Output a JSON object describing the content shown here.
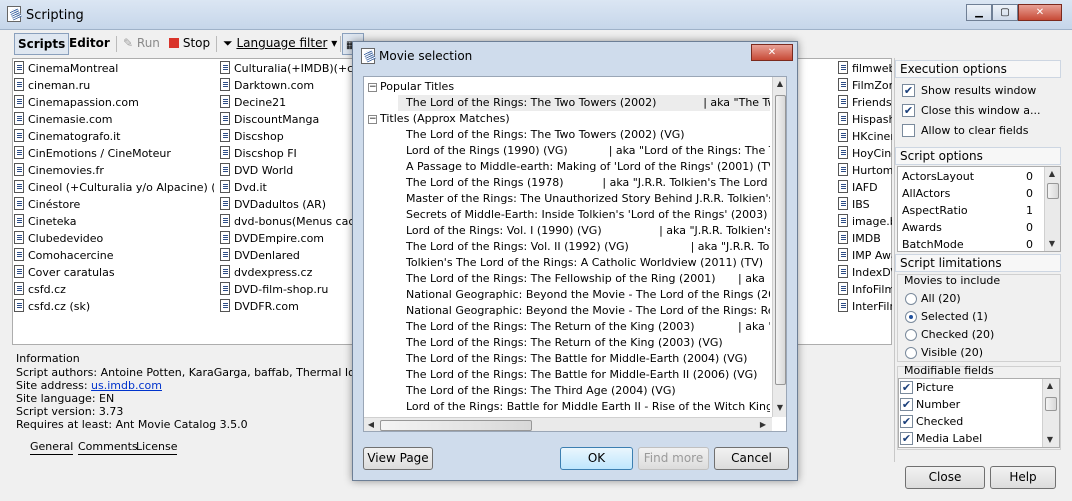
{
  "window": {
    "title": "Scripting"
  },
  "toolbar": {
    "scripts": "Scripts",
    "editor": "Editor",
    "run": "Run",
    "stop": "Stop",
    "language_filter": "Language filter"
  },
  "scripts_col1": [
    "CinemaMontreal",
    "cineman.ru",
    "Cinemapassion.com",
    "Cinemasie.com",
    "Cinematografo.it",
    "CinEmotions / CineMoteur",
    "Cinemovies.fr",
    "Cineol (+Culturalia y/o Alpacine) (ES)",
    "Cinéstore",
    "Cineteka",
    "Clubedevideo",
    "Comohacercine",
    "Cover caratulas",
    "csfd.cz",
    "csfd.cz (sk)"
  ],
  "scripts_col2": [
    "Culturalia(+IMDB)(+cara",
    "Darktown.com",
    "Decine21",
    "DiscountManga",
    "Discshop",
    "Discshop FI",
    "DVD World",
    "Dvd.it",
    "DVDadultos (AR)",
    "dvd-bonus(Menus cache",
    "DVDEmpire.com",
    "DVDenlared",
    "dvdexpress.cz",
    "DVD-film-shop.ru",
    "DVDFR.com"
  ],
  "scripts_col3": [
    "filmweb.",
    "FilmZona",
    "Friends-",
    "Hispasha",
    "HKcinem",
    "HoyCine",
    "HurtomC",
    "IAFD",
    "IBS",
    "image.b",
    "IMDB",
    "IMP Awa",
    "IndexDV",
    "InfoFilm",
    "InterFilm"
  ],
  "info": {
    "heading": "Information",
    "authors": "Script authors: Antoine Potten, KaraGarga, baffab, Thermal Ions, bad",
    "site_label": "Site address: ",
    "site_link": "us.imdb.com",
    "language": "Site language: EN",
    "version": "Script version: 3.73",
    "requires": "Requires at least: Ant Movie Catalog 3.5.0"
  },
  "tabs": [
    "General",
    "Comments",
    "License"
  ],
  "execution_options": {
    "heading": "Execution options",
    "items": [
      {
        "label": "Show results window",
        "checked": true
      },
      {
        "label": "Close this window a...",
        "checked": true
      },
      {
        "label": "Allow to clear fields",
        "checked": false
      }
    ]
  },
  "script_options": {
    "heading": "Script options",
    "items": [
      {
        "name": "ActorsLayout",
        "value": "0"
      },
      {
        "name": "AllActors",
        "value": "0"
      },
      {
        "name": "AspectRatio",
        "value": "1"
      },
      {
        "name": "Awards",
        "value": "0"
      },
      {
        "name": "BatchMode",
        "value": "0"
      }
    ]
  },
  "script_limitations": {
    "heading": "Script limitations",
    "movies_label": "Movies to include",
    "radios": [
      {
        "label": "All (20)",
        "selected": false
      },
      {
        "label": "Selected (1)",
        "selected": true
      },
      {
        "label": "Checked (20)",
        "selected": false
      },
      {
        "label": "Visible (20)",
        "selected": false
      }
    ],
    "fields_label": "Modifiable fields",
    "fields": [
      {
        "label": "Picture",
        "checked": true
      },
      {
        "label": "Number",
        "checked": true
      },
      {
        "label": "Checked",
        "checked": true
      },
      {
        "label": "Media Label",
        "checked": true
      }
    ]
  },
  "main_buttons": {
    "close": "Close",
    "help": "Help"
  },
  "dialog": {
    "title": "Movie selection",
    "popular_heading": "Popular Titles",
    "popular": [
      {
        "title": "The Lord of the Rings: The Two Towers (2002)",
        "aka": "| aka \"The Two"
      }
    ],
    "approx_heading": "Titles (Approx Matches)",
    "approx": [
      {
        "title": "The Lord of the Rings: The Two Towers (2002) (VG)",
        "aka": ""
      },
      {
        "title": "Lord of the Rings (1990) (VG)",
        "aka": "| aka \"Lord of the Rings: The Two"
      },
      {
        "title": "A Passage to Middle-earth: Making of 'Lord of the Rings' (2001) (TV)",
        "aka": ""
      },
      {
        "title": "The Lord of the Rings (1978)",
        "aka": "| aka \"J.R.R. Tolkien's The Lord o"
      },
      {
        "title": "Master of the Rings: The Unauthorized Story Behind J.R.R. Tolkien's 'Lord of",
        "aka": ""
      },
      {
        "title": "Secrets of Middle-Earth: Inside Tolkien's 'Lord of the Rings' (2003) (V)",
        "aka": ""
      },
      {
        "title": "Lord of the Rings: Vol. I (1990) (VG)",
        "aka": "| aka \"J.R.R. Tolkien's"
      },
      {
        "title": "The Lord of the Rings: Vol. II (1992) (VG)",
        "aka": "| aka \"J.R.R. Tolkien's"
      },
      {
        "title": "Tolkien's The Lord of the Rings: A Catholic Worldview (2011) (TV)",
        "aka": ""
      },
      {
        "title": "The Lord of the Rings: The Fellowship of the Ring (2001)",
        "aka": "| aka"
      },
      {
        "title": "National Geographic: Beyond the Movie - The Lord of the Rings (2002) (TV)",
        "aka": ""
      },
      {
        "title": "National Geographic: Beyond the Movie - The Lord of the Rings: Return of th",
        "aka": ""
      },
      {
        "title": "The Lord of the Rings: The Return of the King (2003)",
        "aka": "| aka \"The"
      },
      {
        "title": "The Lord of the Rings: The Return of the King (2003) (VG)",
        "aka": ""
      },
      {
        "title": "The Lord of the Rings: The Battle for Middle-Earth (2004) (VG)",
        "aka": ""
      },
      {
        "title": "The Lord of the Rings: The Battle for Middle-Earth II (2006) (VG)",
        "aka": ""
      },
      {
        "title": "The Lord of the Rings: The Third Age (2004) (VG)",
        "aka": ""
      },
      {
        "title": "Lord of the Rings: Battle for Middle Earth II - Rise of the Witch King (2006) (",
        "aka": ""
      }
    ],
    "buttons": {
      "view_page": "View Page",
      "ok": "OK",
      "find_more": "Find more",
      "cancel": "Cancel"
    }
  }
}
